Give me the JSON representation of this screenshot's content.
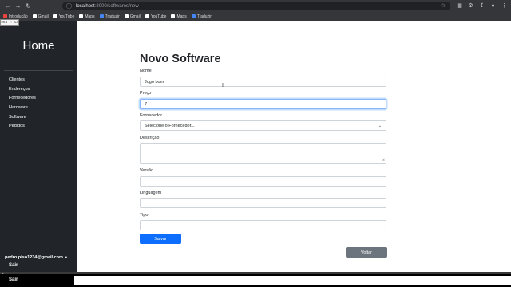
{
  "browser": {
    "url_host": "localhost",
    "url_path": ":8000/softwares/new",
    "bookmarks": [
      {
        "label": "Introdução",
        "color": "#e8453c"
      },
      {
        "label": "Gmail",
        "color": "#ffffff"
      },
      {
        "label": "YouTube",
        "color": "#ffffff"
      },
      {
        "label": "Maps",
        "color": "#ffffff"
      },
      {
        "label": "Traduzir",
        "color": "#4285f4"
      },
      {
        "label": "Gmail",
        "color": "#ffffff"
      },
      {
        "label": "YouTube",
        "color": "#ffffff"
      },
      {
        "label": "Maps",
        "color": "#ffffff"
      },
      {
        "label": "Traduzir",
        "color": "#4285f4"
      }
    ]
  },
  "zoom_overlay": "256 × ac",
  "sidebar": {
    "brand": "Home",
    "items": [
      "Clientes",
      "Endereços",
      "Fornecedores",
      "Hardware",
      "Software",
      "Pedidos"
    ],
    "user": "pedro.piso1234@gmail.com",
    "logout": "Sair"
  },
  "form": {
    "title": "Novo Software",
    "fields": {
      "nome": {
        "label": "Nome",
        "value": "Jogo bom"
      },
      "preco": {
        "label": "Preço",
        "value": "7"
      },
      "fornecedor": {
        "label": "Fornecedor",
        "value": "Selecione o Fornecedor..."
      },
      "descricao": {
        "label": "Descrição",
        "value": ""
      },
      "versao": {
        "label": "Versão",
        "value": ""
      },
      "linguagem": {
        "label": "Linguagem",
        "value": ""
      },
      "tipo": {
        "label": "Tipo",
        "value": ""
      }
    },
    "submit_label": "Salvar",
    "back_label": "Voltar"
  },
  "colors": {
    "primary": "#0d6efd",
    "secondary": "#6c757d",
    "sidebar": "#212529"
  },
  "icons": {
    "back": "arrow-left-icon",
    "forward": "arrow-right-icon",
    "reload": "reload-icon",
    "star": "star-icon"
  }
}
